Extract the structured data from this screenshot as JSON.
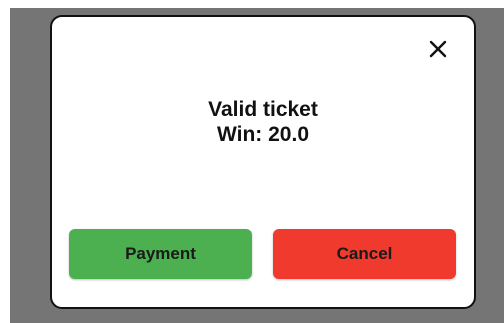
{
  "dialog": {
    "close_icon": "close-icon",
    "message_line1": "Valid ticket",
    "message_line2": "Win: 20.0"
  },
  "buttons": {
    "payment_label": "Payment",
    "cancel_label": "Cancel"
  },
  "colors": {
    "backdrop": "#757575",
    "payment": "#4caf50",
    "cancel": "#f03a2e"
  }
}
